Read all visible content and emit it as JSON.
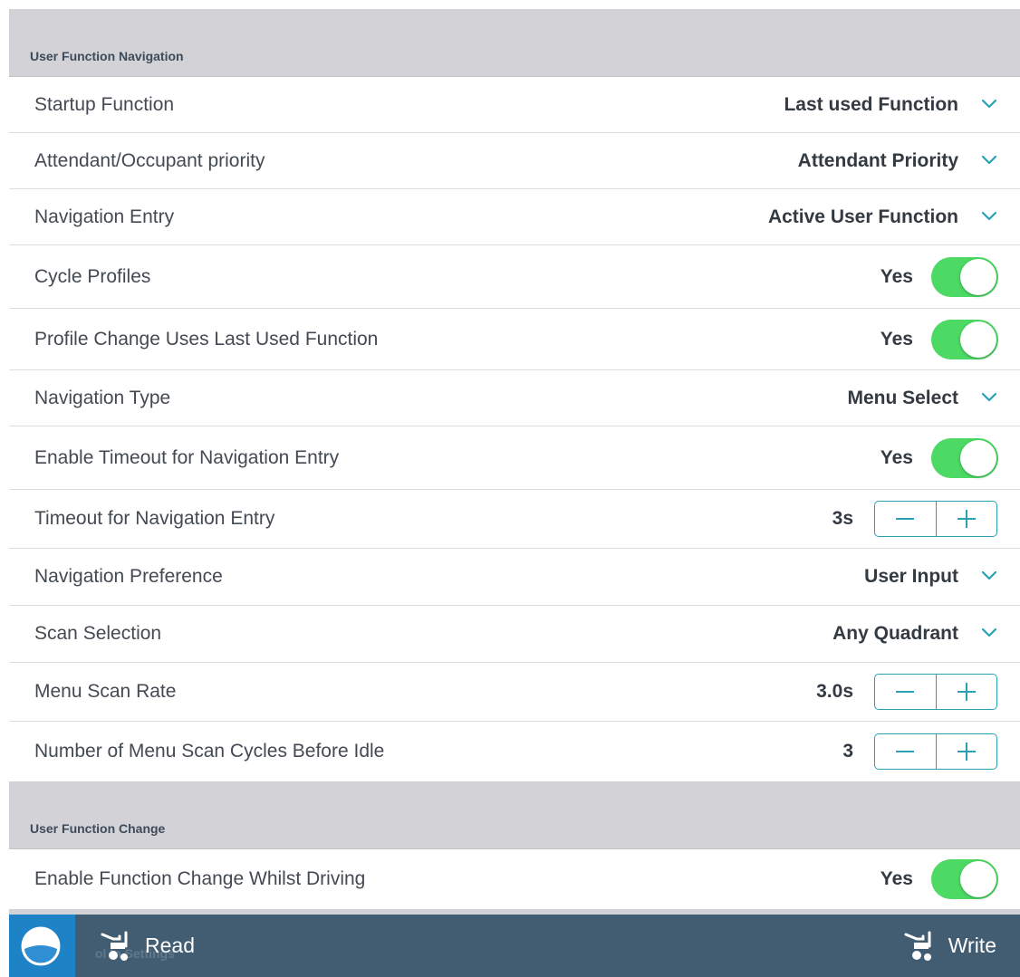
{
  "sections": {
    "navigation": {
      "title": "User Function Navigation"
    },
    "change": {
      "title": "User Function Change"
    }
  },
  "rows": {
    "startup_function": {
      "label": "Startup Function",
      "value": "Last used Function"
    },
    "priority": {
      "label": "Attendant/Occupant priority",
      "value": "Attendant Priority"
    },
    "navigation_entry": {
      "label": "Navigation Entry",
      "value": "Active User Function"
    },
    "cycle_profiles": {
      "label": "Cycle Profiles",
      "value": "Yes",
      "on": true
    },
    "profile_change": {
      "label": "Profile Change Uses Last Used Function",
      "value": "Yes",
      "on": true
    },
    "navigation_type": {
      "label": "Navigation Type",
      "value": "Menu Select"
    },
    "enable_timeout": {
      "label": "Enable Timeout for Navigation Entry",
      "value": "Yes",
      "on": true
    },
    "timeout": {
      "label": "Timeout for Navigation Entry",
      "value": "3s"
    },
    "nav_preference": {
      "label": "Navigation Preference",
      "value": "User Input"
    },
    "scan_selection": {
      "label": "Scan Selection",
      "value": "Any Quadrant"
    },
    "menu_scan_rate": {
      "label": "Menu Scan Rate",
      "value": "3.0s"
    },
    "scan_cycles": {
      "label": "Number of Menu Scan Cycles Before Idle",
      "value": "3"
    },
    "function_change_driving": {
      "label": "Enable Function Change Whilst Driving",
      "value": "Yes",
      "on": true
    }
  },
  "bottom_bar": {
    "read_label": "Read",
    "write_label": "Write",
    "obscured_text": "ol In      Settings"
  },
  "colors": {
    "accent": "#2aa1b3",
    "toggle_on": "#4cd964",
    "section_bg": "#d3d3d7",
    "bar_bg": "#425d72",
    "home_bg": "#1d82c6"
  },
  "icons": {
    "chevron": "chevron-down-icon",
    "read": "read-chair-icon",
    "write": "write-chair-icon",
    "home": "home-logo-icon"
  }
}
